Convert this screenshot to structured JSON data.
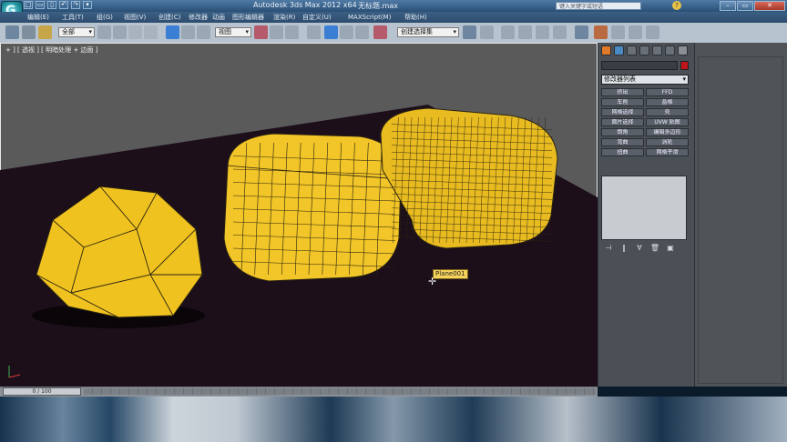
{
  "window": {
    "title": "Autodesk 3ds Max  2012 x64",
    "filename": "无标题.max",
    "search_placeholder": "键入关键字或短语",
    "logo_glyph": "G"
  },
  "quick_access": [
    "□",
    "▭",
    "▯",
    "↶",
    "↷",
    "▾"
  ],
  "menu": {
    "items": [
      "编辑(E)",
      "工具(T)",
      "组(G)",
      "视图(V)",
      "创建(C)",
      "修改器",
      "动画",
      "图形编辑器",
      "渲染(R)",
      "自定义(U)",
      "MAXScript(M)",
      "帮助(H)"
    ]
  },
  "toolbar": {
    "selection_set": "全部",
    "reference_coord": "视图",
    "named_selection": "创建选择集"
  },
  "viewport": {
    "label": "+ ] [ 透视 ] [ 明暗处理 + 边面 ]",
    "tooltip": "Plane001"
  },
  "command_panel": {
    "modifier_list": "修改器列表",
    "buttons": [
      "挤出",
      "FFD",
      "车削",
      "晶格",
      "网格选择",
      "壳",
      "面片选择",
      "UVW 贴图",
      "倒角",
      "编辑多边形",
      "弯曲",
      "涡轮",
      "扭曲",
      "网格平滑"
    ]
  },
  "timeline": {
    "frame": "0 / 100"
  },
  "colors": {
    "background": "#5a5a5b",
    "object_fill": "#f0c21f",
    "wire": "#2b2410",
    "accent_red": "#c0141b"
  }
}
